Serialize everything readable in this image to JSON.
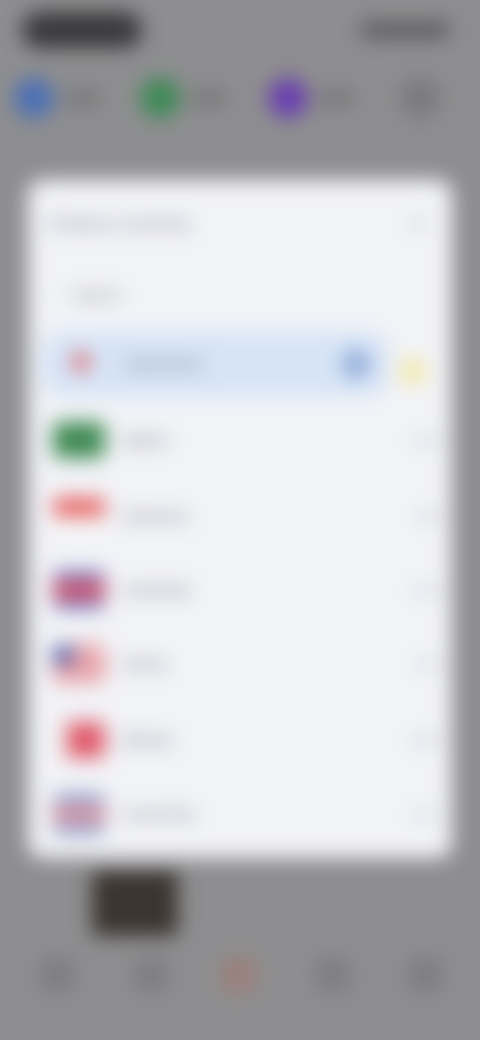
{
  "modal": {
    "title": "Choose a currency",
    "close_glyph": "✕",
    "search": {
      "placeholder": "Search",
      "icon": "search-icon"
    },
    "selected": {
      "name": "Switzerland",
      "code": "CHF",
      "check_glyph": "✓",
      "star_glyph": "★"
    },
    "items": [
      {
        "name": "Algeria",
        "code": "DZD",
        "flag": [
          "#3f8a52",
          "#3f8a52",
          "#f3f3f3"
        ]
      },
      {
        "name": "Indonesia",
        "code": "IDR",
        "flag": [
          "#e65a5a",
          "#e65a5a",
          "#f5f5f5"
        ]
      },
      {
        "name": "Cambodia",
        "code": "KHR",
        "flag": [
          "#5b62b8",
          "#e35d6a",
          "#5b62b8"
        ]
      },
      {
        "name": "Liberia",
        "code": "LRD",
        "flag": [
          "#4b5aa3",
          "#e05a66",
          "#f1f1f1"
        ]
      },
      {
        "name": "Bahrain",
        "code": "BHD",
        "flag": [
          "#e05a6a",
          "#f1f1f1",
          "#e05a6a"
        ]
      },
      {
        "name": "Costa Rica",
        "code": "CRC",
        "flag": [
          "#d46474",
          "#f1f1f1",
          "#4a5ea8"
        ]
      }
    ]
  },
  "background": {
    "quick_colors": [
      "#4a6fb5",
      "#3d8a55",
      "#6a3fb0",
      "#7a7a7c"
    ]
  }
}
